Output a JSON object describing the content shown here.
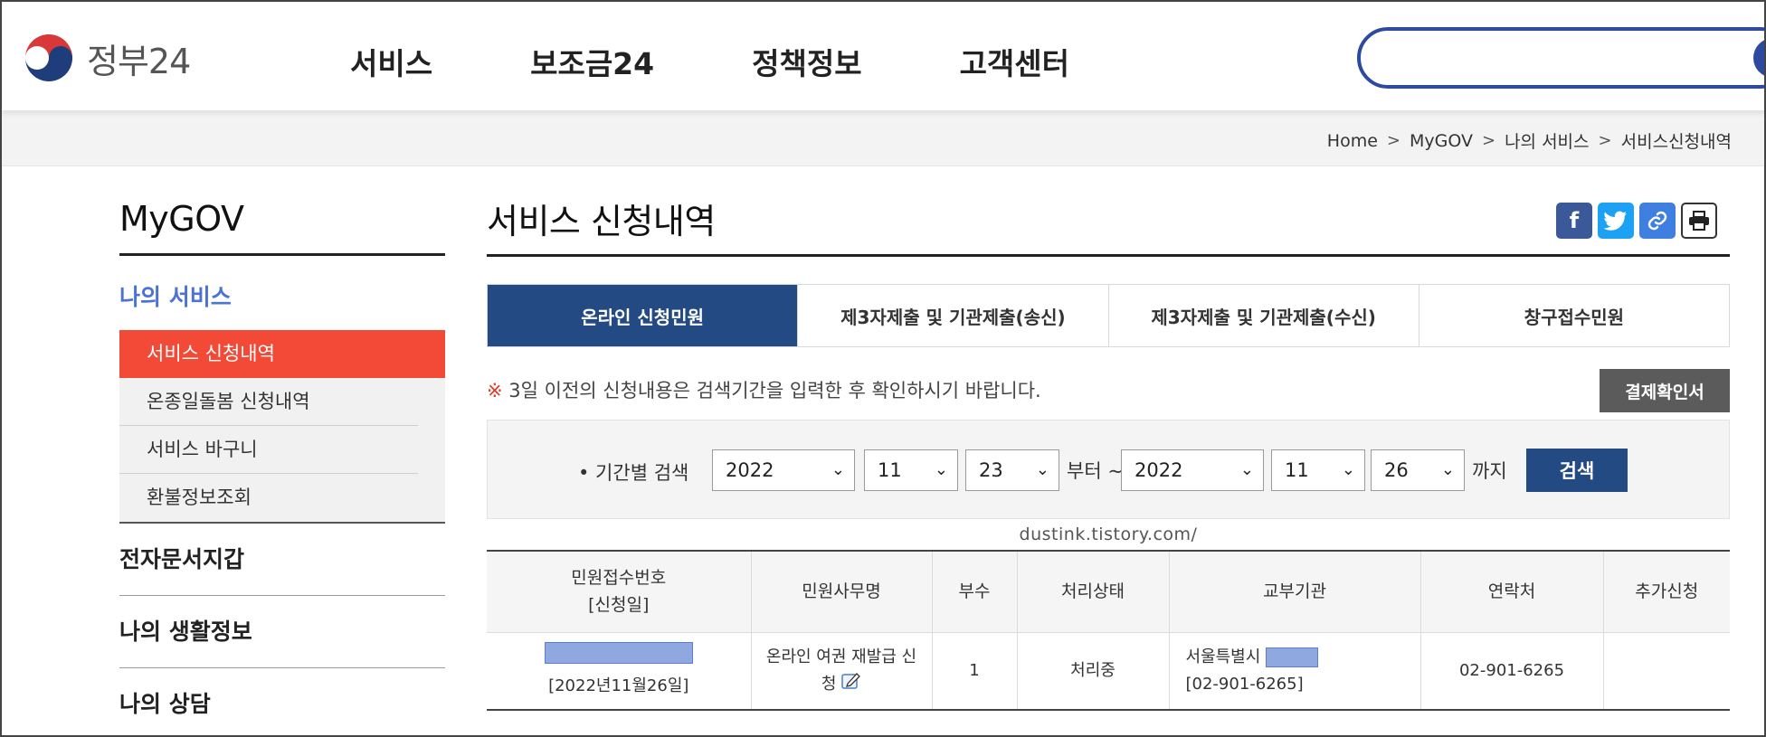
{
  "header": {
    "logo_text": "정부24",
    "nav": [
      "서비스",
      "보조금24",
      "정책정보",
      "고객센터"
    ]
  },
  "breadcrumb": [
    "Home",
    "MyGOV",
    "나의 서비스",
    "서비스신청내역"
  ],
  "sidebar": {
    "title": "MyGOV",
    "subtitle": "나의 서비스",
    "items": [
      "서비스 신청내역",
      "온종일돌봄 신청내역",
      "서비스 바구니",
      "환불정보조회"
    ],
    "sections": [
      "전자문서지갑",
      "나의 생활정보",
      "나의 상담"
    ]
  },
  "main": {
    "title": "서비스 신청내역",
    "tabs": [
      "온라인 신청민원",
      "제3자제출 및 기관제출(송신)",
      "제3자제출 및 기관제출(수신)",
      "창구접수민원"
    ],
    "notice_mark": "※",
    "notice": "3일 이전의 신청내용은 검색기간을 입력한 후 확인하시기 바랍니다.",
    "receipt_button": "결제확인서",
    "search": {
      "label": "• 기간별 검색",
      "from_year": "2022",
      "from_month": "11",
      "from_day": "23",
      "from_text": "부터 ~",
      "to_year": "2022",
      "to_month": "11",
      "to_day": "26",
      "to_text": "까지",
      "button": "검색"
    },
    "watermark": "dustink.tistory.com/",
    "table": {
      "headers": [
        "민원접수번호",
        "[신청일]",
        "민원사무명",
        "부수",
        "처리상태",
        "교부기관",
        "연락처",
        "추가신청"
      ],
      "row": {
        "date": "[2022년11월26일]",
        "name_line1": "온라인 여권 재발급 신",
        "name_line2": "청",
        "copies": "1",
        "status": "처리중",
        "agency": "서울특별시",
        "agency_phone": "[02-901-6265]",
        "contact": "02-901-6265",
        "extra": ""
      }
    }
  },
  "colors": {
    "accent": "#244a84",
    "active_menu": "#f24a37",
    "sub_link": "#4b73d6"
  }
}
